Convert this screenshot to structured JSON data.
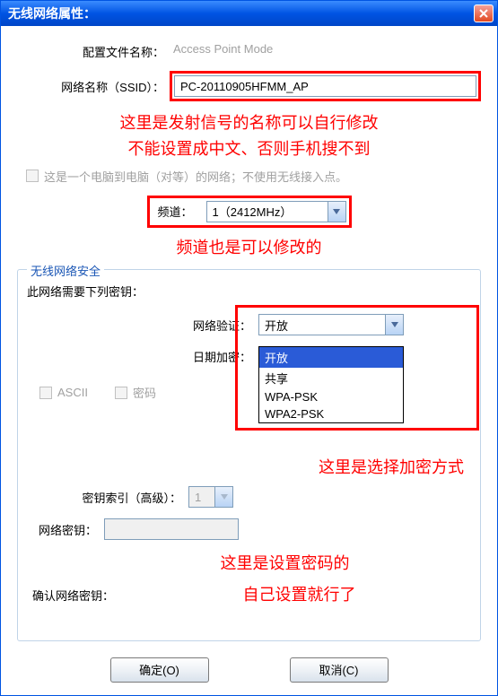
{
  "title": "无线网络属性：",
  "config_file_label": "配置文件名称：",
  "config_file_value": "Access Point Mode",
  "ssid_label": "网络名称（SSID）：",
  "ssid_value": "PC-20110905HFMM_AP",
  "annotation_ssid_1": "这里是发射信号的名称可以自行修改",
  "annotation_ssid_2": "不能设置成中文、否则手机搜不到",
  "adhoc_checkbox_label": "这是一个电脑到电脑（对等）的网络；不使用无线接入点。",
  "channel_label": "频道：",
  "channel_value": "1（2412MHz）",
  "annotation_channel": "频道也是可以修改的",
  "security_legend": "无线网络安全",
  "security_note": "此网络需要下列密钥：",
  "auth_label": "网络验证：",
  "auth_value": "开放",
  "auth_options": [
    "开放",
    "共享",
    "WPA-PSK",
    "WPA2-PSK"
  ],
  "encrypt_label": "日期加密：",
  "ascii_label": "ASCII",
  "passphrase_label": "密码",
  "annotation_encrypt": "这里是选择加密方式",
  "keyindex_label": "密钥索引（高级）：",
  "keyindex_value": "1",
  "netkey_label": "网络密钥：",
  "annotation_pwd_1": "这里是设置密码的",
  "confirmkey_label": "确认网络密钥：",
  "annotation_pwd_2": "自己设置就行了",
  "ok_label": "确定(O)",
  "cancel_label": "取消(C)"
}
